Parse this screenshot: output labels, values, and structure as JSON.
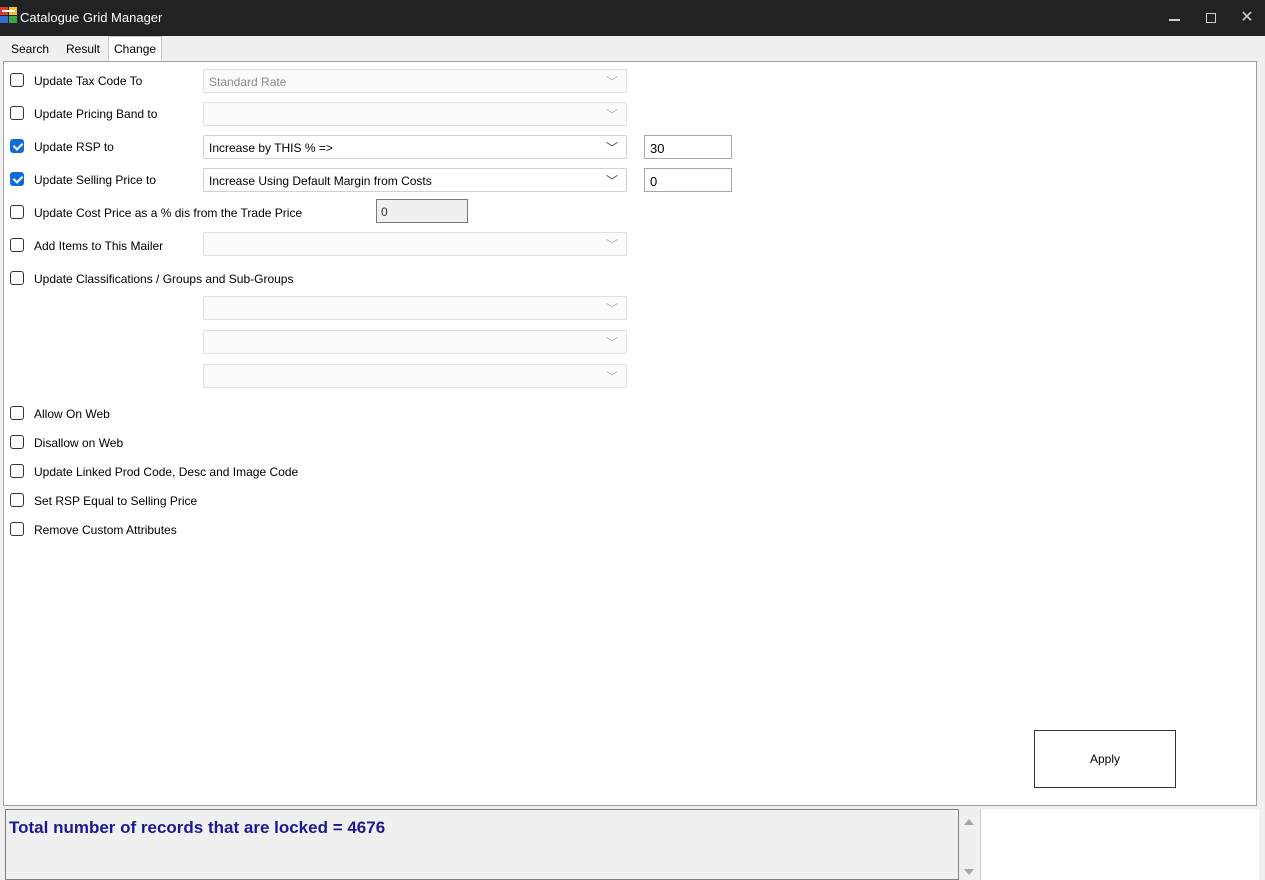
{
  "window": {
    "title": "Catalogue Grid Manager",
    "minimize": "–",
    "close": "✕"
  },
  "tabs": [
    {
      "label": "Search"
    },
    {
      "label": "Result"
    },
    {
      "label": "Change",
      "active": true
    }
  ],
  "options": {
    "tax_code": {
      "label": "Update Tax Code To",
      "checked": false,
      "combo_value": "Standard Rate"
    },
    "pricing_band": {
      "label": "Update Pricing Band to",
      "checked": false,
      "combo_value": ""
    },
    "rsp": {
      "label": "Update RSP to",
      "checked": true,
      "combo_value": "Increase by THIS % =>",
      "input_value": "30"
    },
    "selling_price": {
      "label": "Update Selling Price to",
      "checked": true,
      "combo_value": "Increase Using Default Margin from Costs",
      "input_value": "0"
    },
    "cost_price": {
      "label": "Update Cost Price as a % dis from the Trade Price",
      "checked": false,
      "input_value": "0"
    },
    "mailer": {
      "label": "Add Items to This Mailer",
      "checked": false,
      "combo_value": ""
    },
    "classifications": {
      "label": "Update Classifications / Groups and Sub-Groups",
      "checked": false,
      "combos": [
        "",
        "",
        ""
      ]
    },
    "allow_web": {
      "label": "Allow On Web",
      "checked": false
    },
    "disallow_web": {
      "label": "Disallow on Web",
      "checked": false
    },
    "linked_prod": {
      "label": "Update Linked Prod Code, Desc and Image Code",
      "checked": false
    },
    "rsp_equal": {
      "label": "Set RSP Equal to Selling Price",
      "checked": false
    },
    "remove_attrs": {
      "label": "Remove Custom Attributes",
      "checked": false
    }
  },
  "apply_label": "Apply",
  "status": {
    "message": "Total number of records that are locked = 4676"
  },
  "icons": {
    "chevron": "﹀"
  }
}
